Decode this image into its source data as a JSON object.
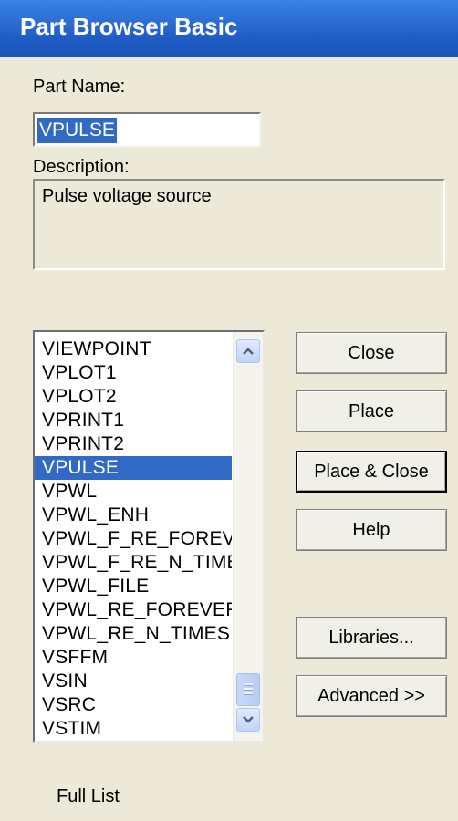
{
  "window": {
    "title": "Part Browser Basic"
  },
  "part_name": {
    "label": "Part Name:",
    "value": "VPULSE"
  },
  "description": {
    "label": "Description:",
    "value": "Pulse voltage source"
  },
  "parts_list": {
    "items": [
      "VIEWPOINT",
      "VPLOT1",
      "VPLOT2",
      "VPRINT1",
      "VPRINT2",
      "VPULSE",
      "VPWL",
      "VPWL_ENH",
      "VPWL_F_RE_FOREVER",
      "VPWL_F_RE_N_TIMES",
      "VPWL_FILE",
      "VPWL_RE_FOREVER",
      "VPWL_RE_N_TIMES",
      "VSFFM",
      "VSIN",
      "VSRC",
      "VSTIM"
    ],
    "selected": "VPULSE"
  },
  "buttons": {
    "close": "Close",
    "place": "Place",
    "place_close": "Place & Close",
    "help": "Help",
    "libraries": "Libraries...",
    "advanced": "Advanced >>"
  },
  "status": {
    "list_mode": "Full List"
  },
  "icons": {
    "scroll_up": "chevron-up-icon",
    "scroll_down": "chevron-down-icon",
    "scroll_grip": "grip-icon"
  },
  "colors": {
    "title_bar": "#1e5bc4",
    "selection": "#316ac5",
    "dialog_bg": "#ece9d8"
  }
}
